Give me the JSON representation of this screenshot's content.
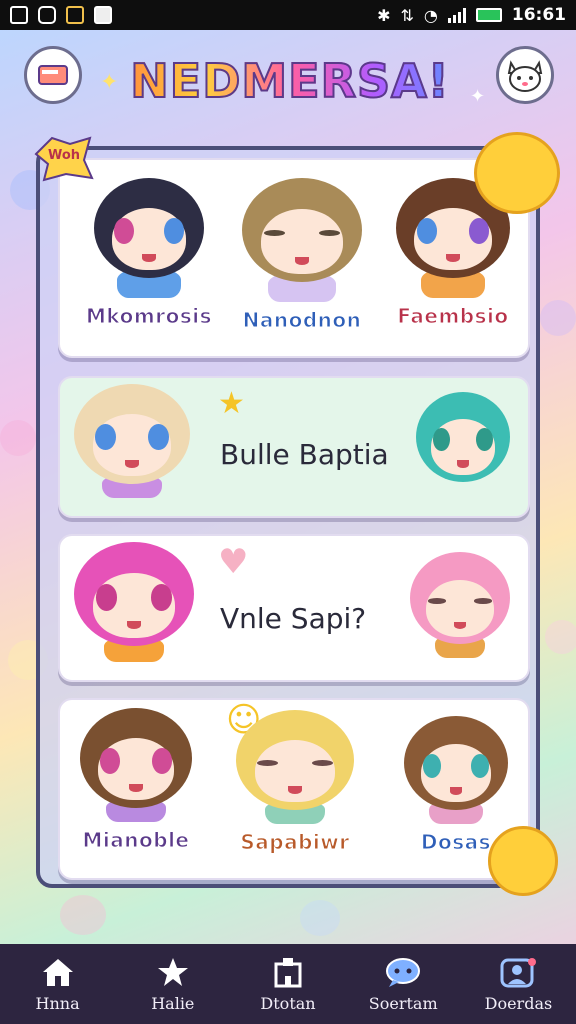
{
  "status_bar": {
    "time": "16:61"
  },
  "header": {
    "title": "NEDMERSA!"
  },
  "panel": {
    "tag": "Woh",
    "cards": [
      {
        "characters": [
          {
            "name": "Mkomrosis"
          },
          {
            "name": "Nanodnon"
          },
          {
            "name": "Faembsio"
          }
        ]
      },
      {
        "phrase": "Bulle Baptia"
      },
      {
        "phrase": "Vnle Sapi?"
      },
      {
        "characters": [
          {
            "name": "Mianoble"
          },
          {
            "name": "Sapabiwr"
          },
          {
            "name": "Dosas"
          }
        ]
      }
    ]
  },
  "nav": {
    "items": [
      {
        "label": "Hnna",
        "icon": "home-icon"
      },
      {
        "label": "Halie",
        "icon": "star-icon"
      },
      {
        "label": "Dtotan",
        "icon": "building-icon"
      },
      {
        "label": "Soertam",
        "icon": "chat-icon"
      },
      {
        "label": "Doerdas",
        "icon": "profile-icon"
      }
    ]
  },
  "colors": {
    "accent": "#5b3a8a",
    "nav_bg": "#2d2540",
    "panel_border": "#4b4e78"
  }
}
